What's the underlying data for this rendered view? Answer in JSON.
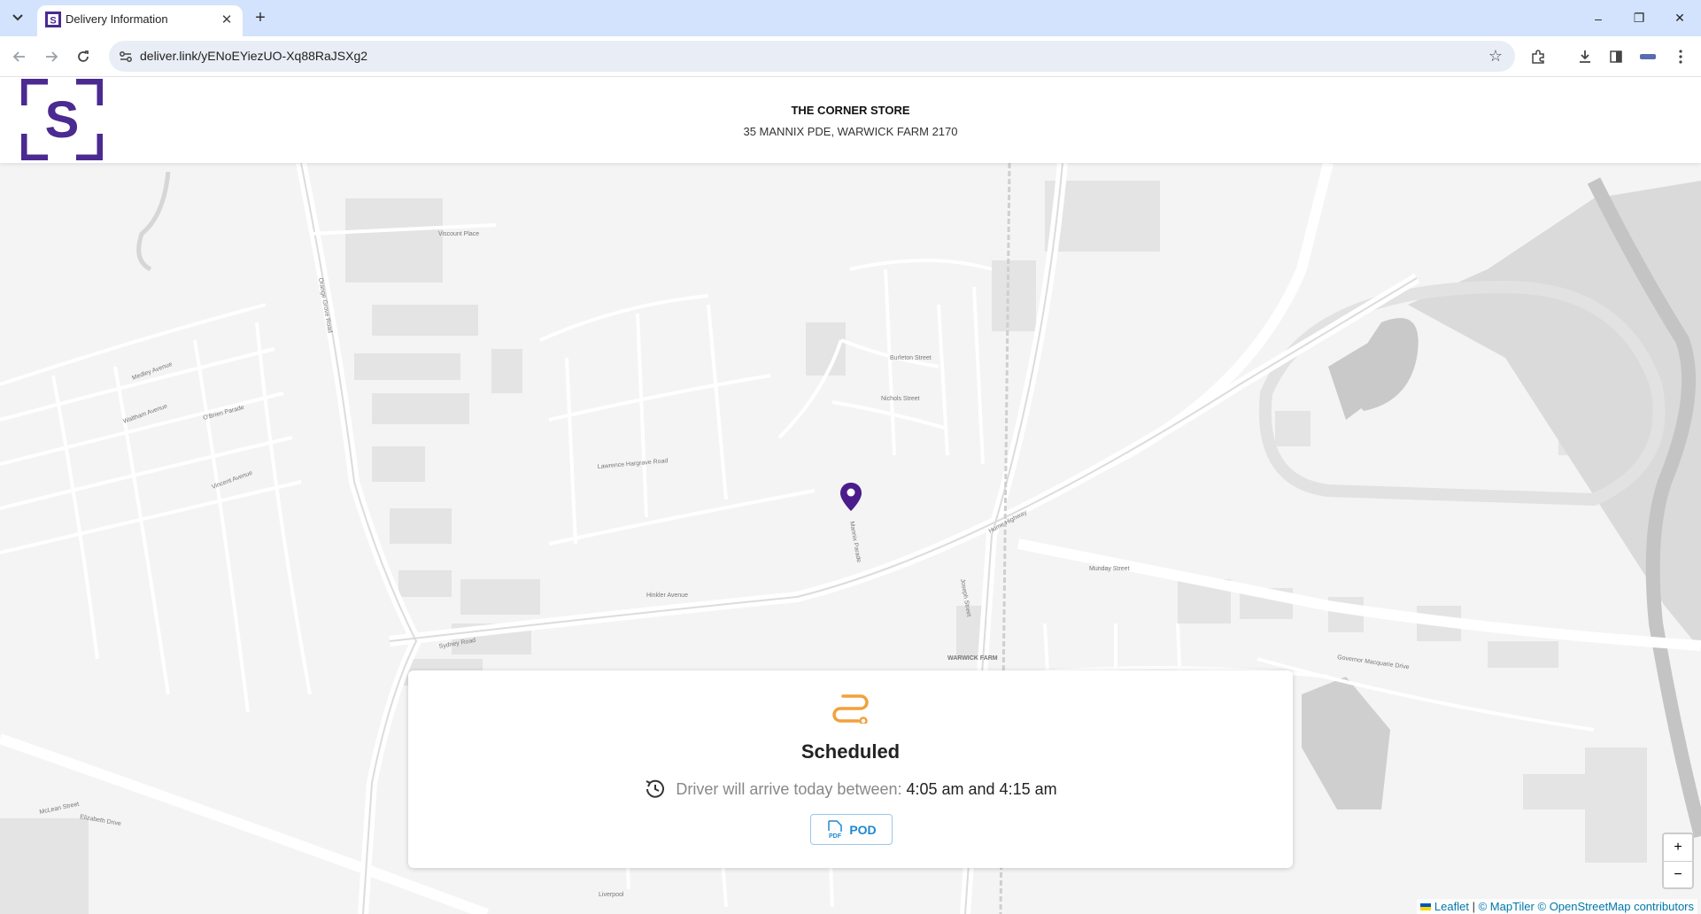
{
  "browser": {
    "tab_title": "Delivery Information",
    "url": "deliver.link/yENoEYiezUO-Xq88RaJSXg2",
    "controls": {
      "minimize": "–",
      "restore": "❐",
      "close": "✕",
      "new_tab": "+"
    }
  },
  "header": {
    "store_name": "THE CORNER STORE",
    "store_address": "35 MANNIX PDE, WARWICK FARM 2170",
    "logo_letter": "S",
    "brand_color": "#4b2a91"
  },
  "map": {
    "labels": [
      "Viscount Place",
      "Hume Highway",
      "Sydney Road",
      "WARWICK FARM",
      "Elizabeth Drive",
      "Liverpool",
      "Munday Street",
      "Governor Macquarie Drive",
      "Lawrence Hargrave Road",
      "Nichols Street",
      "Mannix Parade",
      "Orange Grove Road",
      "Medley Avenue",
      "Waltham Avenue",
      "O'Brien Parade",
      "Vincent Avenue",
      "McLean Street",
      "Hinkler Avenue",
      "Burleton Street",
      "Joseph Street"
    ],
    "zoom_in": "+",
    "zoom_out": "−",
    "attribution": {
      "leaflet": "Leaflet",
      "sep": "|",
      "maptiler": "© MapTiler",
      "osm": "© OpenStreetMap contributors"
    }
  },
  "delivery": {
    "status": "Scheduled",
    "eta_label": "Driver will arrive today between:",
    "eta_time": "4:05 am and 4:15 am",
    "pod_label": "POD",
    "pod_icon_text": "PDF",
    "accent_color": "#f2a13a",
    "pod_color": "#1e88d2"
  }
}
